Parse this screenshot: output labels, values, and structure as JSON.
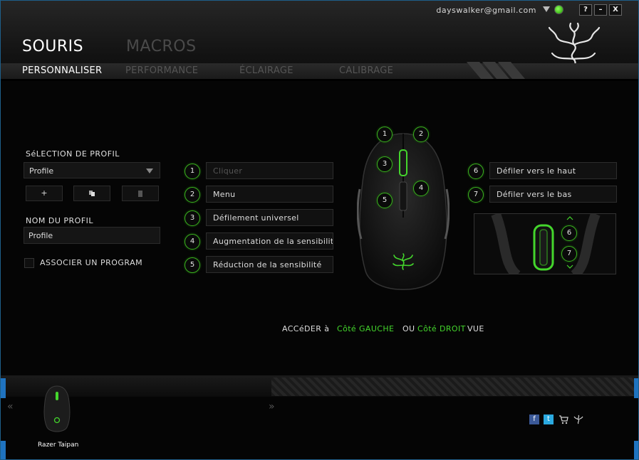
{
  "account": {
    "email": "dayswalker@gmail.com"
  },
  "window_buttons": {
    "help": "?",
    "minimize": "–",
    "close": "X"
  },
  "main_tabs": [
    {
      "label": "SOURIS"
    },
    {
      "label": "MACROS"
    }
  ],
  "sub_tabs": [
    {
      "label": "PERSONNALISER"
    },
    {
      "label": "PERFORMANCE"
    },
    {
      "label": "ÉCLAIRAGE"
    },
    {
      "label": "CALIBRAGE"
    }
  ],
  "profile": {
    "selection_label": "SéLECTION DE PROFIL",
    "selected": "Profile",
    "add_label": "+",
    "name_label": "NOM DU PROFIL",
    "name_value": "Profile",
    "associate_label": "ASSOCIER UN PROGRAM"
  },
  "buttons_left": [
    {
      "num": "1",
      "label": "Cliquer"
    },
    {
      "num": "2",
      "label": "Menu"
    },
    {
      "num": "3",
      "label": "Défilement universel"
    },
    {
      "num": "4",
      "label": "Augmentation de la sensibilité"
    },
    {
      "num": "5",
      "label": "Réduction de la sensibilité"
    }
  ],
  "buttons_right": [
    {
      "num": "6",
      "label": "Défiler vers le haut"
    },
    {
      "num": "7",
      "label": "Défiler vers le bas"
    }
  ],
  "mouse_markers": [
    "1",
    "2",
    "3",
    "4",
    "5"
  ],
  "inset_markers": [
    "6",
    "7"
  ],
  "access": {
    "prefix": "ACCéDER à",
    "left": "Côté GAUCHE",
    "or": "OU",
    "right": "Côté DROIT",
    "suffix": "VUE"
  },
  "device": {
    "name": "Razer Taipan"
  },
  "nav": {
    "prev": "«",
    "next": "»"
  },
  "colors": {
    "accent": "#44d62c",
    "edge": "#1f73c0"
  }
}
